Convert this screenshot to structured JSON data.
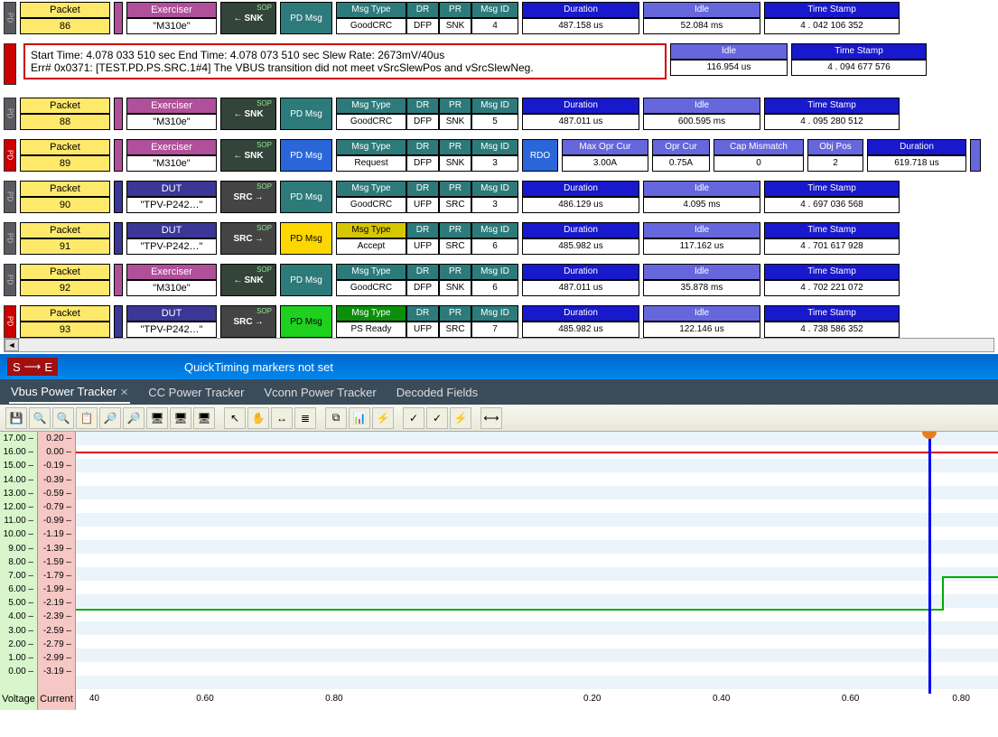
{
  "packets": [
    {
      "pd": "PD",
      "pdRed": false,
      "num": "86",
      "srcType": "Exerciser",
      "srcVal": "\"M310e\"",
      "dir": "SNK",
      "dirArrow": "←",
      "dirSrc": false,
      "pdmsg": "PD Msg",
      "pdmsgClass": "pdmsg-teal",
      "msgHdr": "teal",
      "msgType": "GoodCRC",
      "dr": "DFP",
      "pr": "SNK",
      "msgId": "4",
      "duration": "487.158 us",
      "idle": "52.084 ms",
      "ts": "4 . 042 106 352"
    },
    {
      "pd": "PD",
      "pdRed": false,
      "num": "88",
      "srcType": "Exerciser",
      "srcVal": "\"M310e\"",
      "dir": "SNK",
      "dirArrow": "←",
      "dirSrc": false,
      "pdmsg": "PD Msg",
      "pdmsgClass": "pdmsg-teal",
      "msgHdr": "teal",
      "msgType": "GoodCRC",
      "dr": "DFP",
      "pr": "SNK",
      "msgId": "5",
      "duration": "487.011 us",
      "idle": "600.595 ms",
      "ts": "4 . 095 280 512"
    },
    {
      "pd": "PD",
      "pdRed": true,
      "num": "89",
      "srcType": "Exerciser",
      "srcVal": "\"M310e\"",
      "dir": "SNK",
      "dirArrow": "←",
      "dirSrc": false,
      "pdmsg": "PD Msg",
      "pdmsgClass": "pdmsg-blue",
      "msgHdr": "teal",
      "msgType": "Request",
      "dr": "DFP",
      "pr": "SNK",
      "msgId": "3",
      "isRDO": true,
      "rdoLabel": "RDO",
      "maxOpr": "3.00A",
      "oprCur": "0.75A",
      "capMis": "0",
      "objPos": "2",
      "rdoDuration": "619.718 us"
    },
    {
      "pd": "PD",
      "pdRed": false,
      "num": "90",
      "srcType": "DUT",
      "srcVal": "\"TPV-P242…\"",
      "dir": "SRC",
      "dirArrow": "→",
      "dirSrc": true,
      "pdmsg": "PD Msg",
      "pdmsgClass": "pdmsg-teal",
      "msgHdr": "teal",
      "msgType": "GoodCRC",
      "dr": "UFP",
      "pr": "SRC",
      "msgId": "3",
      "duration": "486.129 us",
      "idle": "4.095 ms",
      "ts": "4 . 697 036 568"
    },
    {
      "pd": "PD",
      "pdRed": false,
      "num": "91",
      "srcType": "DUT",
      "srcVal": "\"TPV-P242…\"",
      "dir": "SRC",
      "dirArrow": "→",
      "dirSrc": true,
      "pdmsg": "PD Msg",
      "pdmsgClass": "pdmsg-yellow",
      "msgHdr": "yellow",
      "msgType": "Accept",
      "dr": "UFP",
      "pr": "SRC",
      "msgId": "6",
      "duration": "485.982 us",
      "idle": "117.162 us",
      "ts": "4 . 701 617 928"
    },
    {
      "pd": "PD",
      "pdRed": false,
      "num": "92",
      "srcType": "Exerciser",
      "srcVal": "\"M310e\"",
      "dir": "SNK",
      "dirArrow": "←",
      "dirSrc": false,
      "pdmsg": "PD Msg",
      "pdmsgClass": "pdmsg-teal",
      "msgHdr": "teal",
      "msgType": "GoodCRC",
      "dr": "DFP",
      "pr": "SNK",
      "msgId": "6",
      "duration": "487.011 us",
      "idle": "35.878 ms",
      "ts": "4 . 702 221 072"
    },
    {
      "pd": "PD",
      "pdRed": true,
      "num": "93",
      "srcType": "DUT",
      "srcVal": "\"TPV-P242…\"",
      "dir": "SRC",
      "dirArrow": "→",
      "dirSrc": true,
      "pdmsg": "PD Msg",
      "pdmsgClass": "pdmsg-green",
      "msgHdr": "green",
      "msgType": "PS Ready",
      "dr": "UFP",
      "pr": "SRC",
      "msgId": "7",
      "duration": "485.982 us",
      "idle": "122.146 us",
      "ts": "4 . 738 586 352"
    }
  ],
  "errBox": {
    "line1": "Start Time: 4.078 033 510 sec End Time: 4.078 073 510 sec Slew Rate: 2673mV/40us",
    "line2": "Err#  0x0371: [TEST.PD.PS.SRC.1#4] The VBUS transition did not meet vSrcSlewPos and vSrcSlewNeg."
  },
  "errRight": {
    "idle": "116.954 us",
    "ts": "4 . 094 677 576"
  },
  "labels": {
    "packet": "Packet",
    "exerciser": "Exerciser",
    "dut": "DUT",
    "sop": "SOP",
    "msgType": "Msg Type",
    "dr": "DR",
    "pr": "PR",
    "msgId": "Msg ID",
    "duration": "Duration",
    "idle": "Idle",
    "timestamp": "Time Stamp",
    "maxOpr": "Max Opr Cur",
    "oprCur": "Opr Cur",
    "capMis": "Cap Mismatch",
    "objPos": "Obj Pos"
  },
  "quicktiming": {
    "se_s": "S",
    "se_e": "E",
    "text": "QuickTiming markers not set"
  },
  "tabs": [
    "Vbus Power Tracker",
    "CC Power Tracker",
    "Vconn Power Tracker",
    "Decoded Fields"
  ],
  "toolbarIcons": [
    "💾",
    "🔍",
    "🔍",
    "📋",
    "🔎",
    "🔎",
    "🖥",
    "🖥",
    "🖥",
    " ",
    "↖",
    "✋",
    "↔",
    "≣",
    " ",
    "⧉",
    "📊",
    "⚡",
    " ",
    "✓",
    "✓",
    "⚡",
    " ",
    "⟷"
  ],
  "chart_data": {
    "type": "line",
    "voltage_ticks": [
      "17.00",
      "16.00",
      "15.00",
      "14.00",
      "13.00",
      "12.00",
      "11.00",
      "10.00",
      "9.00",
      "8.00",
      "7.00",
      "6.00",
      "5.00",
      "4.00",
      "3.00",
      "2.00",
      "1.00",
      "0.00"
    ],
    "current_ticks": [
      "0.20",
      "0.00",
      "-0.19",
      "-0.39",
      "-0.59",
      "-0.79",
      "-0.99",
      "-1.19",
      "-1.39",
      "-1.59",
      "-1.79",
      "-1.99",
      "-2.19",
      "-2.39",
      "-2.59",
      "-2.79",
      "-2.99",
      "-3.19"
    ],
    "x_ticks": [
      "40",
      "0.60",
      "0.80",
      "",
      "0.20",
      "0.40",
      "0.60",
      "0.80",
      ""
    ],
    "ylabel_v": "Voltage",
    "ylabel_c": "Current",
    "series": [
      {
        "name": "voltage",
        "color": "#d00",
        "approx_value": 16.0
      },
      {
        "name": "current",
        "color": "#0a0",
        "approx_value": -2.19,
        "step_to": -1.79
      }
    ]
  }
}
